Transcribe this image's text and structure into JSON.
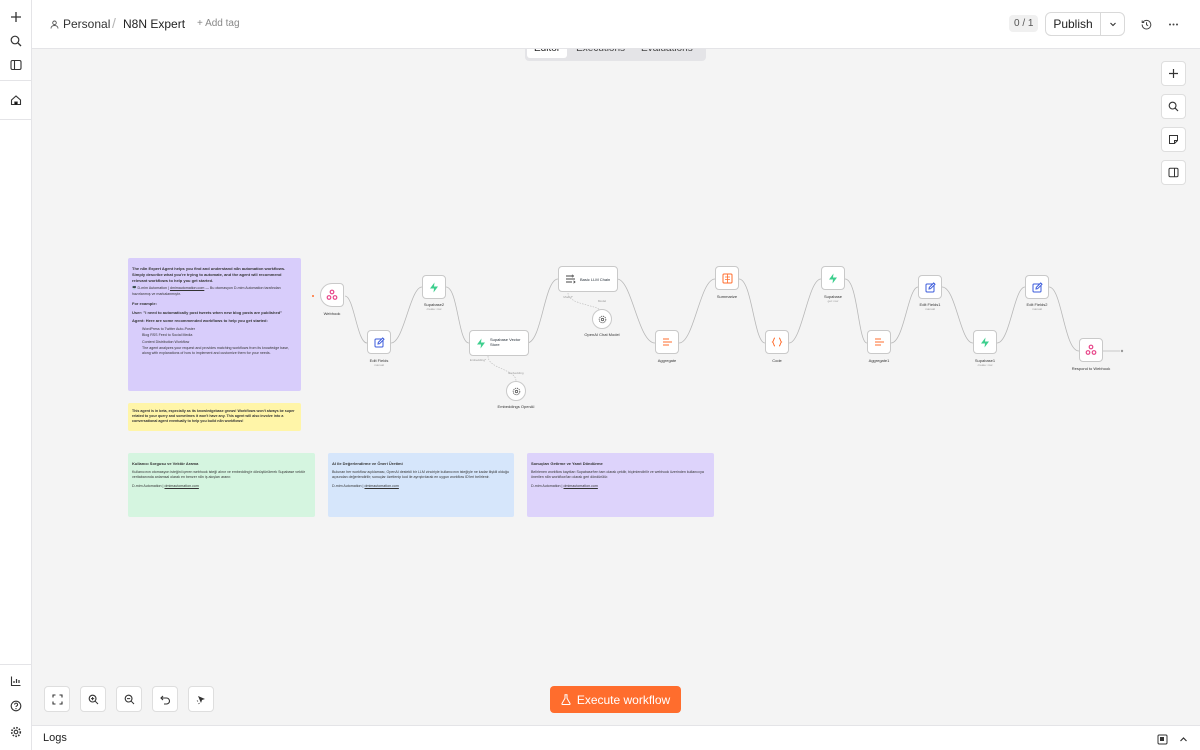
{
  "header": {
    "project": "Personal",
    "workflow_name": "N8N Expert",
    "add_tag": "+ Add tag",
    "version_counter": "0 / 1",
    "publish_label": "Publish"
  },
  "tabs": [
    {
      "label": "Editor",
      "active": true
    },
    {
      "label": "Executions",
      "active": false
    },
    {
      "label": "Evaluations",
      "active": false
    }
  ],
  "notes": {
    "intro": {
      "p1": "The n8n Expert Agent helps you find and understand n8n automation workflows. Simply describe what you're trying to automate, and the agent will recommend relevant workflows to help you get started.",
      "p2_prefix": "🖥️ D-mim Automation |",
      "p2_link": "dmimautomation.com",
      "p2_suffix": "— Bu otomasyon D-mim Automation tarafından hazırlanmış ve markalanmıştır.",
      "example_heading": "For example:",
      "example_user": "User: \"I need to automatically post tweets when new blog posts are published\"",
      "agent_heading": "Agent: Here are some recommended workflows to help you get started:",
      "items": [
        "WordPress to Twitter Auto-Poster",
        "Blog RSS Feed to Social Media",
        "Content Distribution Workflow"
      ],
      "closing": "The agent analyzes your request and provides matching workflows from its knowledge base, along with explanations of how to implement and customize them for your needs."
    },
    "beta": "This agent is in beta, especially as its knowledgebase grows! Workflows won't always be super related to your query and sometimes it won't have any. This agent will also involve into a conversational agent eventually to help you build n8n workflows!",
    "green": {
      "title": "Kullanıcı Sorgusu ve Vektör Arama",
      "body": "Kullanıcının otomasyon isteğini içeren webhook isteği alınır ve embedding'e dönüştürülerek Supabase vektör veritabanında anlamsal olarak en benzer n8n iş akışları aranır.",
      "footer_prefix": "D-mim Automation |",
      "footer_link": "dmimautomation.com"
    },
    "blue": {
      "title": "AI ile Değerlendirme ve Öneri Üretimi",
      "body": "Bulunan her workflow açıklaması, OpenAI destekli bir LLM zinciriyle kullanıcının isteğiyle ne kadar ilişkili olduğu açısından değerlendirilir; sonuçlar özetlenip kod ile ayrıştırılarak en uygun workflow ID'leri belirlenir.",
      "footer_prefix": "D-mim Automation |",
      "footer_link": "dmimautomation.com"
    },
    "purple": {
      "title": "Sonuçları Getirme ve Yanıt Döndürme",
      "body": "Belirlenen workflow kayıtları Supabase'ten tam olarak çekilir, biçimlendirilir ve webhook üzerinden kullanıcıya önerilen n8n workflow'ları olarak geri döndürülür.",
      "footer_prefix": "D-mim Automation |",
      "footer_link": "dmimautomation.com"
    }
  },
  "nodes": {
    "webhook": {
      "label": "Webhook"
    },
    "edit_fields": {
      "label": "Edit Fields",
      "sub": "manual"
    },
    "supabase2": {
      "label": "Supabase2",
      "sub": "create: row"
    },
    "vector_store": {
      "label": "Supabase Vector Store"
    },
    "embeddings": {
      "label": "Embeddings OpenAI"
    },
    "llm_chain": {
      "label": "Basic LLM Chain"
    },
    "chat_model": {
      "label": "OpenAI Chat Model"
    },
    "aggregate": {
      "label": "Aggregate"
    },
    "summarize": {
      "label": "Summarize"
    },
    "code": {
      "label": "Code"
    },
    "supabase": {
      "label": "Supabase",
      "sub": "get: row"
    },
    "aggregate1": {
      "label": "Aggregate1"
    },
    "edit_fields1": {
      "label": "Edit Fields1",
      "sub": "manual"
    },
    "supabase1": {
      "label": "Supabase1",
      "sub": "create: row"
    },
    "edit_fields2": {
      "label": "Edit Fields2",
      "sub": "manual"
    },
    "respond": {
      "label": "Respond to Webhook"
    }
  },
  "ports": {
    "model": "Model*",
    "embedding": "Embedding*",
    "embeddings_in": "Embedding",
    "model_in": "Model"
  },
  "execute_label": "Execute workflow",
  "logs_label": "Logs",
  "colors": {
    "accent": "#ff6d2d",
    "supabase": "#3ecf8e",
    "webhook": "#e8478b",
    "edit": "#3b5bdb",
    "aggregate": "#ff6d2d",
    "note_purple": "#d8cdfb",
    "note_yellow": "#fff5a8",
    "note_green": "#d5f5e0",
    "note_blue": "#d6e6fb"
  }
}
